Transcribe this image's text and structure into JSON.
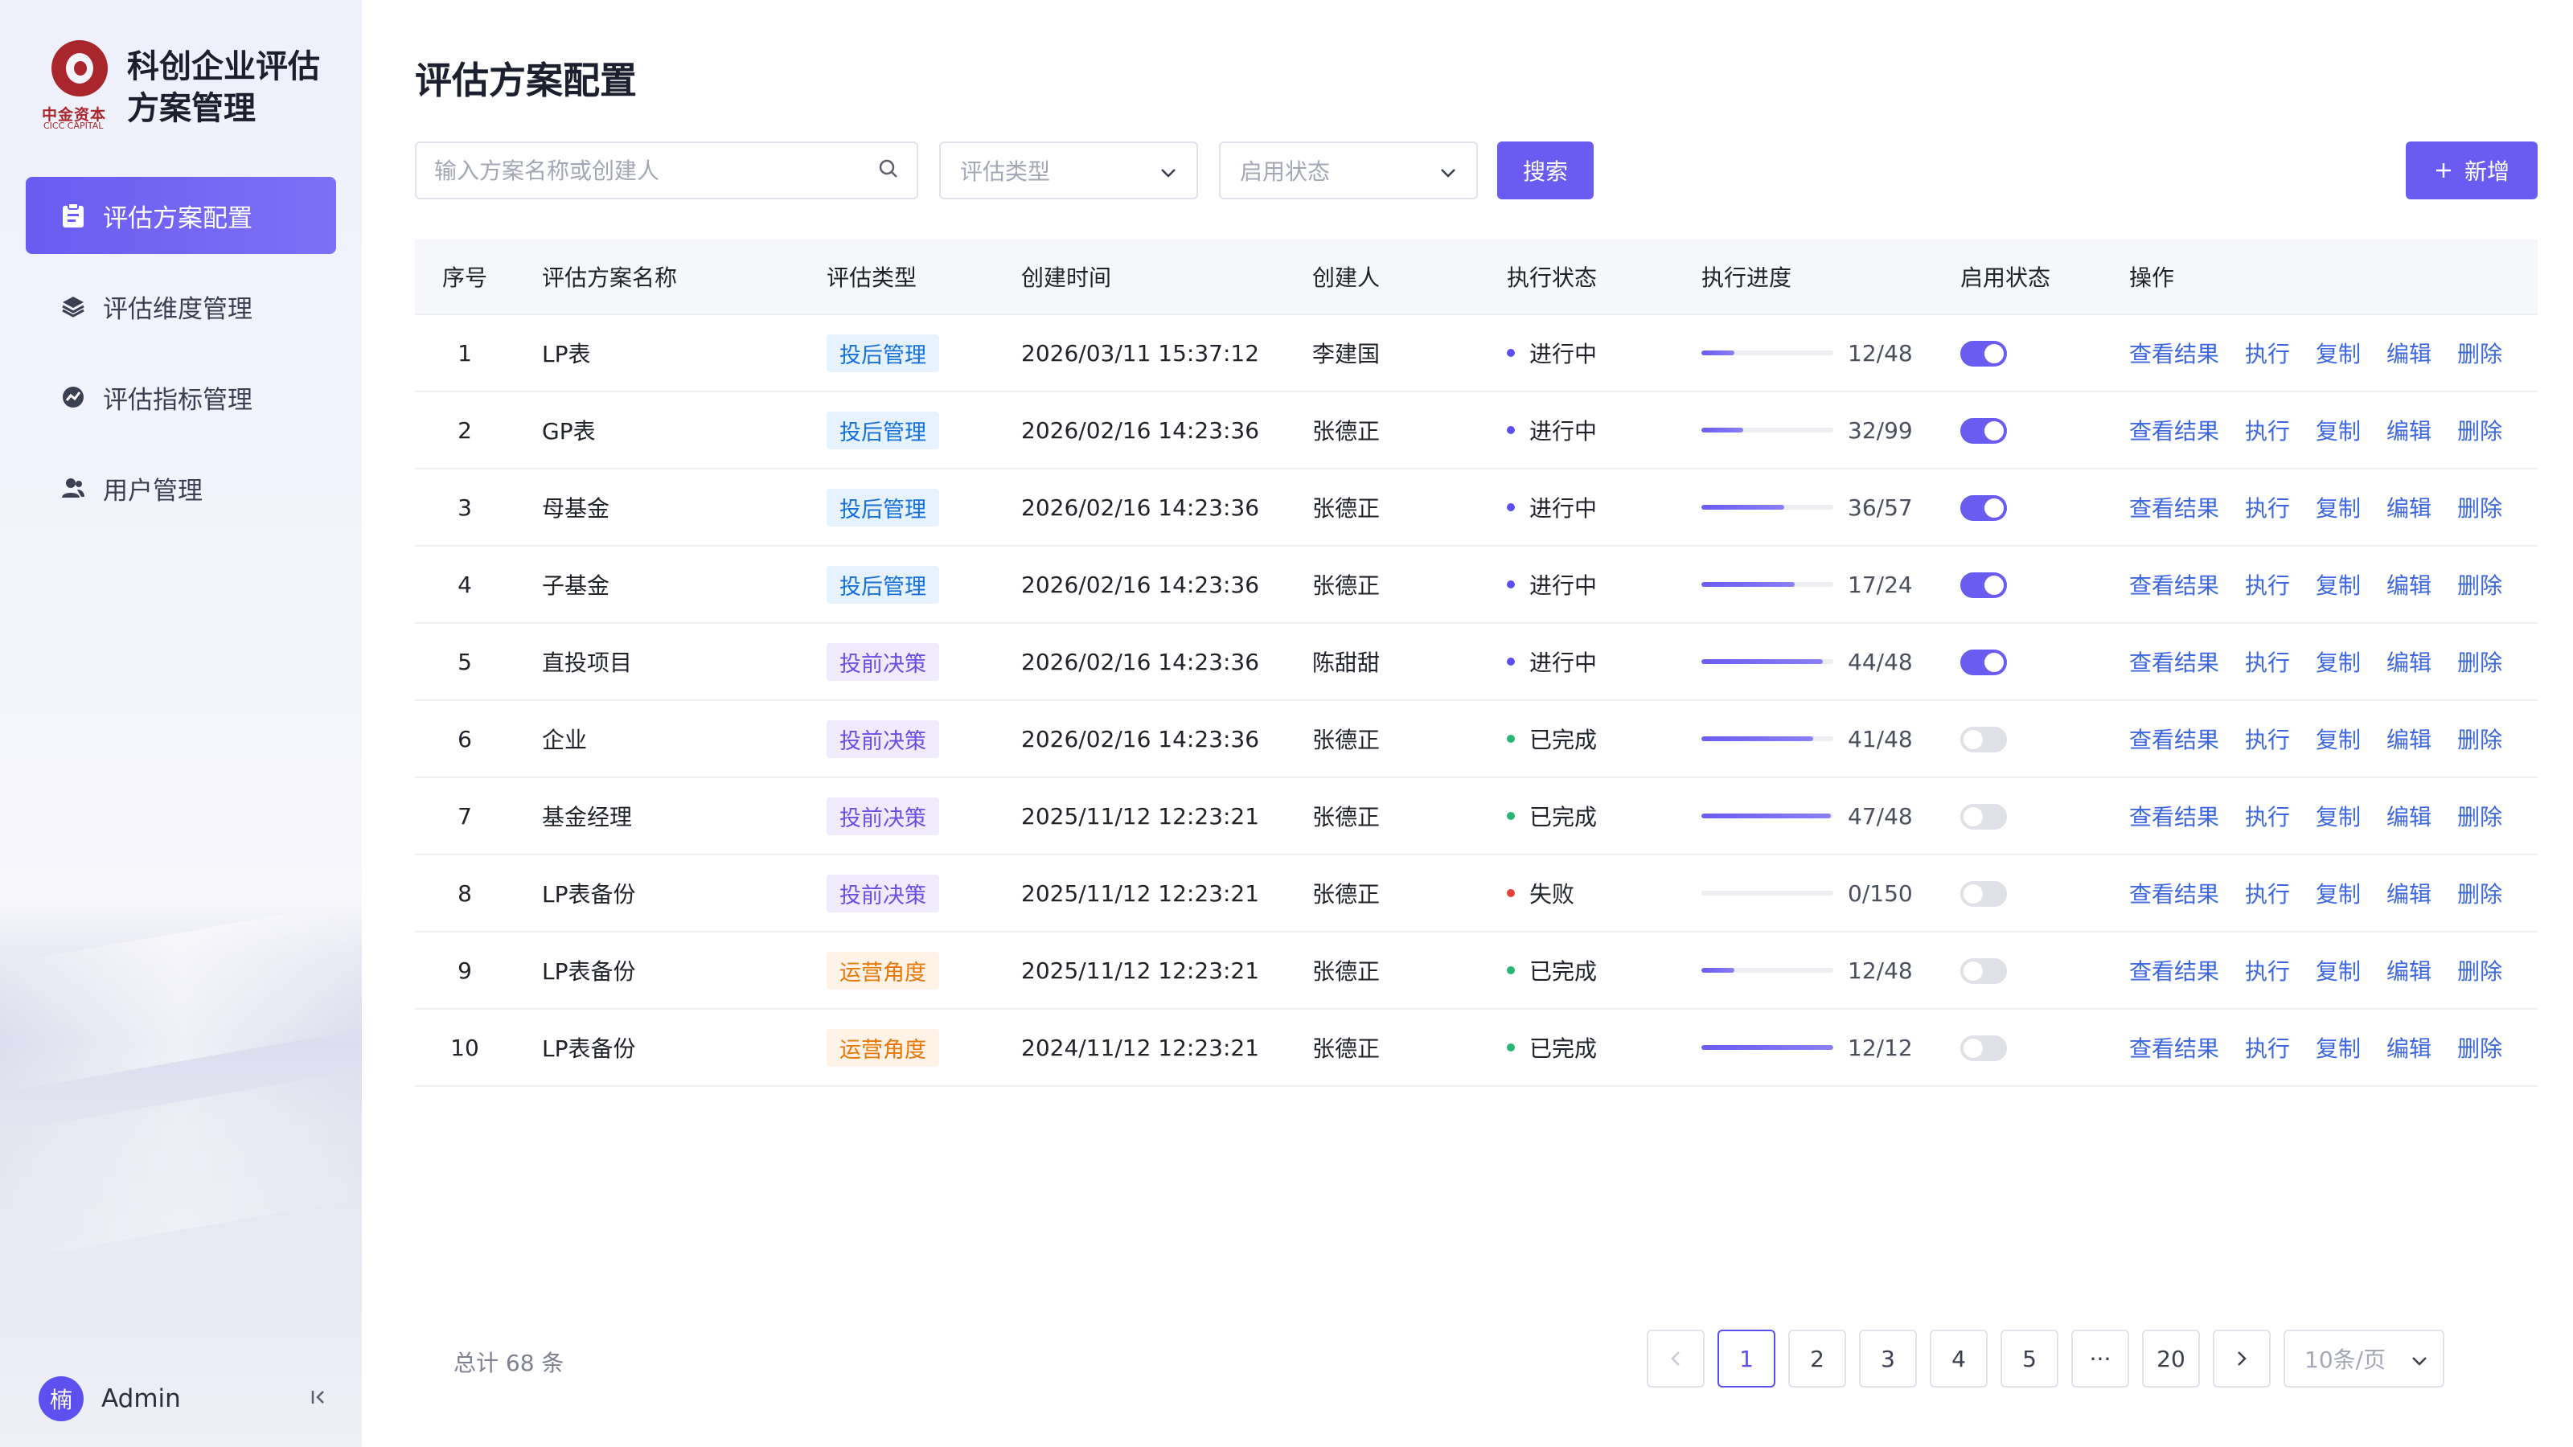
{
  "brand": {
    "title_line1": "科创企业评估",
    "title_line2": "方案管理",
    "logo_cn": "中金资本",
    "logo_en": "CICC CAPITAL"
  },
  "sidebar": {
    "items": [
      {
        "label": "评估方案配置",
        "icon": "clipboard-icon",
        "active": true
      },
      {
        "label": "评估维度管理",
        "icon": "layers-icon",
        "active": false
      },
      {
        "label": "评估指标管理",
        "icon": "chart-circle-icon",
        "active": false
      },
      {
        "label": "用户管理",
        "icon": "user-icon",
        "active": false
      }
    ],
    "user": {
      "avatar_text": "楠",
      "name": "Admin"
    }
  },
  "page": {
    "title": "评估方案配置"
  },
  "filters": {
    "search_placeholder": "输入方案名称或创建人",
    "type_placeholder": "评估类型",
    "status_placeholder": "启用状态",
    "search_label": "搜索",
    "add_label": "新增"
  },
  "table": {
    "headers": [
      "序号",
      "评估方案名称",
      "评估类型",
      "创建时间",
      "创建人",
      "执行状态",
      "执行进度",
      "启用状态",
      "操作"
    ],
    "ops": [
      "查看结果",
      "执行",
      "复制",
      "编辑",
      "删除"
    ],
    "rows": [
      {
        "idx": "1",
        "name": "LP表",
        "type": "投后管理",
        "type_color": "blue",
        "time": "2026/03/11 15:37:12",
        "creator": "李建国",
        "status": "进行中",
        "status_color": "#5b4ff0",
        "progress": "12/48",
        "progress_fraction": 0.25,
        "enabled": true
      },
      {
        "idx": "2",
        "name": "GP表",
        "type": "投后管理",
        "type_color": "blue",
        "time": "2026/02/16 14:23:36",
        "creator": "张德正",
        "status": "进行中",
        "status_color": "#5b4ff0",
        "progress": "32/99",
        "progress_fraction": 0.32,
        "enabled": true
      },
      {
        "idx": "3",
        "name": "母基金",
        "type": "投后管理",
        "type_color": "blue",
        "time": "2026/02/16 14:23:36",
        "creator": "张德正",
        "status": "进行中",
        "status_color": "#5b4ff0",
        "progress": "36/57",
        "progress_fraction": 0.63,
        "enabled": true
      },
      {
        "idx": "4",
        "name": "子基金",
        "type": "投后管理",
        "type_color": "blue",
        "time": "2026/02/16 14:23:36",
        "creator": "张德正",
        "status": "进行中",
        "status_color": "#5b4ff0",
        "progress": "17/24",
        "progress_fraction": 0.71,
        "enabled": true
      },
      {
        "idx": "5",
        "name": "直投项目",
        "type": "投前决策",
        "type_color": "purple",
        "time": "2026/02/16 14:23:36",
        "creator": "陈甜甜",
        "status": "进行中",
        "status_color": "#5b4ff0",
        "progress": "44/48",
        "progress_fraction": 0.92,
        "enabled": true
      },
      {
        "idx": "6",
        "name": "企业",
        "type": "投前决策",
        "type_color": "purple",
        "time": "2026/02/16 14:23:36",
        "creator": "张德正",
        "status": "已完成",
        "status_color": "#2bb673",
        "progress": "41/48",
        "progress_fraction": 0.85,
        "enabled": false
      },
      {
        "idx": "7",
        "name": "基金经理",
        "type": "投前决策",
        "type_color": "purple",
        "time": "2025/11/12 12:23:21",
        "creator": "张德正",
        "status": "已完成",
        "status_color": "#2bb673",
        "progress": "47/48",
        "progress_fraction": 0.98,
        "enabled": false
      },
      {
        "idx": "8",
        "name": "LP表备份",
        "type": "投前决策",
        "type_color": "purple",
        "time": "2025/11/12 12:23:21",
        "creator": "张德正",
        "status": "失败",
        "status_color": "#e8403a",
        "progress": "0/150",
        "progress_fraction": 0.0,
        "enabled": false
      },
      {
        "idx": "9",
        "name": "LP表备份",
        "type": "运营角度",
        "type_color": "orange",
        "time": "2025/11/12 12:23:21",
        "creator": "张德正",
        "status": "已完成",
        "status_color": "#2bb673",
        "progress": "12/48",
        "progress_fraction": 0.25,
        "enabled": false
      },
      {
        "idx": "10",
        "name": "LP表备份",
        "type": "运营角度",
        "type_color": "orange",
        "time": "2024/11/12 12:23:21",
        "creator": "张德正",
        "status": "已完成",
        "status_color": "#2bb673",
        "progress": "12/12",
        "progress_fraction": 1.0,
        "enabled": false
      }
    ]
  },
  "footer": {
    "total": "总计 68 条",
    "pages": [
      "1",
      "2",
      "3",
      "4",
      "5",
      "···",
      "20"
    ],
    "current_page": "1",
    "page_size": "10条/页"
  },
  "colors": {
    "accent": "#6a5cf0",
    "link": "#3d67e0"
  }
}
